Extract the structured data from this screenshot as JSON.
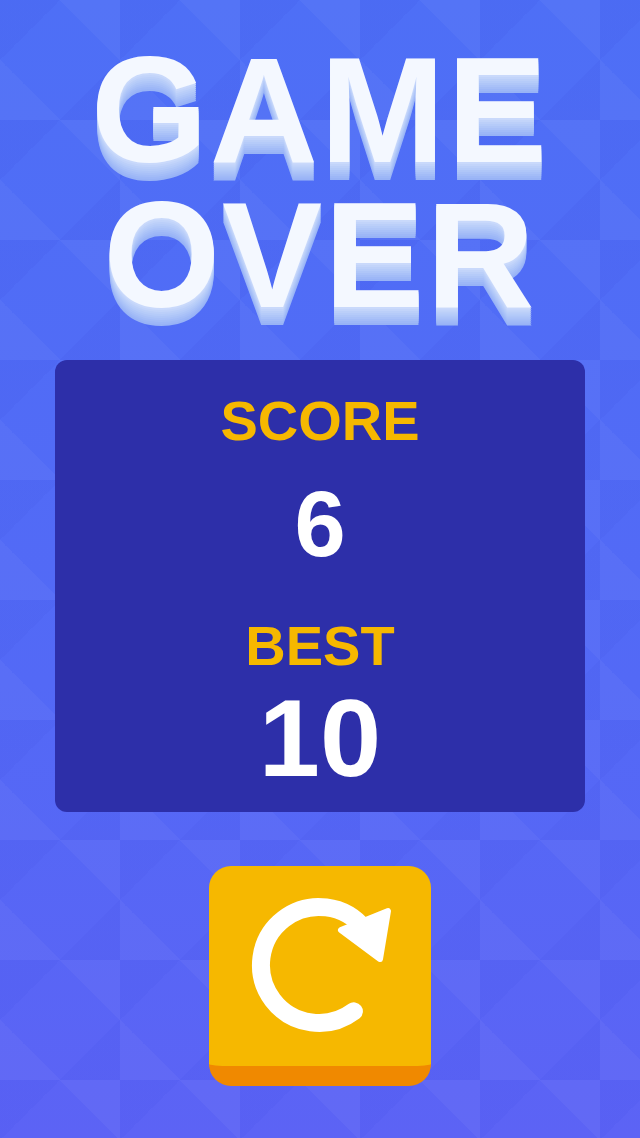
{
  "title": {
    "lines": [
      "GAME",
      "OVER"
    ]
  },
  "score_panel": {
    "stats": [
      {
        "kind": "score",
        "label": "SCORE",
        "value": "6"
      },
      {
        "kind": "best",
        "label": "BEST",
        "value": "10"
      }
    ]
  }
}
